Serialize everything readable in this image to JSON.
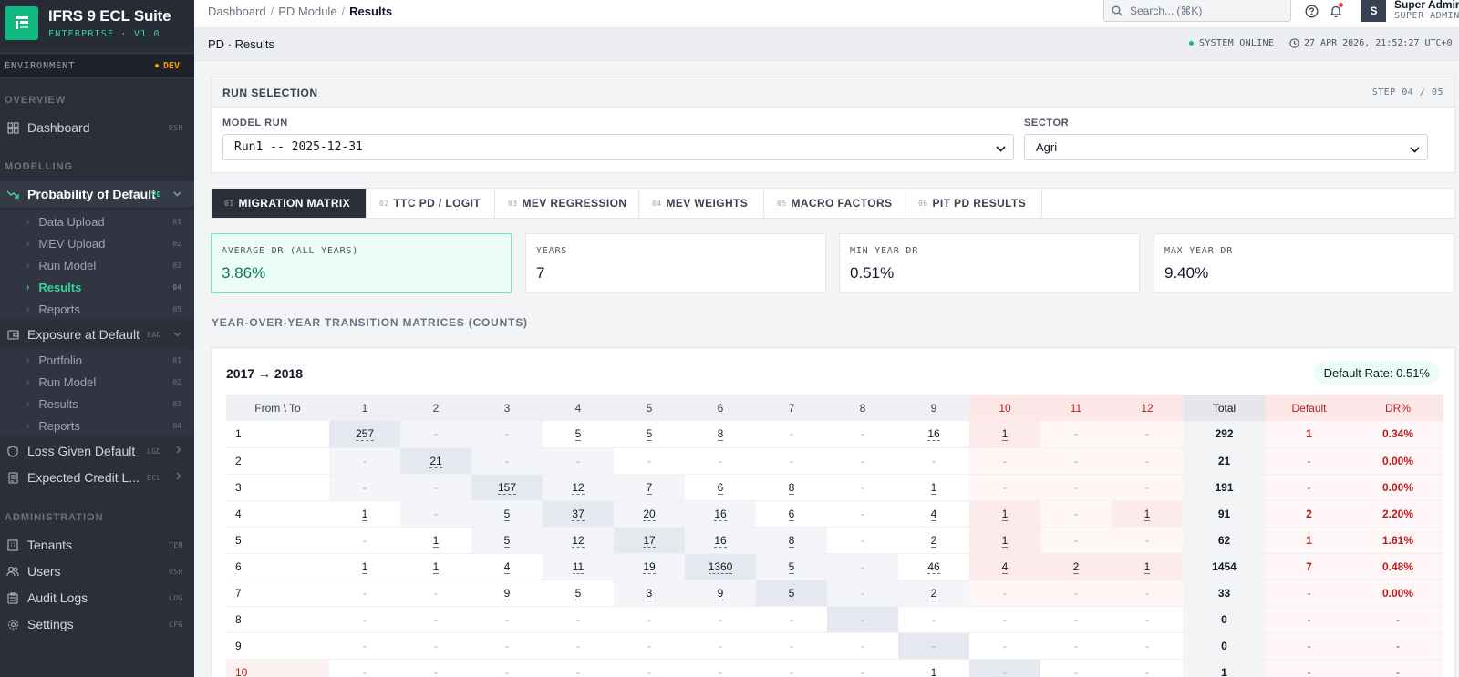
{
  "brand": {
    "title": "IFRS 9 ECL Suite",
    "subtitle": "ENTERPRISE · V1.0"
  },
  "environment": {
    "label": "ENVIRONMENT",
    "value": "DEV"
  },
  "sidebar": {
    "overview_label": "OVERVIEW",
    "modelling_label": "MODELLING",
    "admin_label": "ADMINISTRATION",
    "dashboard": {
      "label": "Dashboard",
      "code": "DSH"
    },
    "pd": {
      "label": "Probability of Default",
      "code": "PD",
      "items": [
        {
          "label": "Data Upload",
          "num": "01"
        },
        {
          "label": "MEV Upload",
          "num": "02"
        },
        {
          "label": "Run Model",
          "num": "03"
        },
        {
          "label": "Results",
          "num": "04"
        },
        {
          "label": "Reports",
          "num": "05"
        }
      ]
    },
    "ead": {
      "label": "Exposure at Default",
      "code": "EAD",
      "items": [
        {
          "label": "Portfolio",
          "num": "01"
        },
        {
          "label": "Run Model",
          "num": "02"
        },
        {
          "label": "Results",
          "num": "03"
        },
        {
          "label": "Reports",
          "num": "04"
        }
      ]
    },
    "lgd": {
      "label": "Loss Given Default",
      "code": "LGD"
    },
    "ecl": {
      "label": "Expected Credit L...",
      "code": "ECL"
    },
    "tenants": {
      "label": "Tenants",
      "code": "TEN"
    },
    "users": {
      "label": "Users",
      "code": "USR"
    },
    "audit": {
      "label": "Audit Logs",
      "code": "LOG"
    },
    "settings": {
      "label": "Settings",
      "code": "CFG"
    }
  },
  "topbar": {
    "breadcrumb": [
      "Dashboard",
      "PD Module",
      "Results"
    ],
    "search_placeholder": "Search... (⌘K)",
    "user_initial": "S",
    "user_name": "Super Admin",
    "user_role": "SUPER ADMIN"
  },
  "pageheader": {
    "title": "PD · Results",
    "status": "SYSTEM ONLINE",
    "datetime": "27 APR 2026, 21:52:27 UTC+0"
  },
  "run_selection": {
    "title": "RUN SELECTION",
    "step": "STEP 04 / 05",
    "model_run_label": "MODEL RUN",
    "model_run_value": "Run1 -- 2025-12-31",
    "sector_label": "SECTOR",
    "sector_value": "Agri"
  },
  "tabs": [
    {
      "num": "01",
      "label": "MIGRATION MATRIX"
    },
    {
      "num": "02",
      "label": "TTC PD / LOGIT"
    },
    {
      "num": "03",
      "label": "MEV REGRESSION"
    },
    {
      "num": "04",
      "label": "MEV WEIGHTS"
    },
    {
      "num": "05",
      "label": "MACRO FACTORS"
    },
    {
      "num": "06",
      "label": "PIT PD RESULTS"
    }
  ],
  "kpis": [
    {
      "label": "AVERAGE DR (ALL YEARS)",
      "value": "3.86%"
    },
    {
      "label": "YEARS",
      "value": "7"
    },
    {
      "label": "MIN YEAR DR",
      "value": "0.51%"
    },
    {
      "label": "MAX YEAR DR",
      "value": "9.40%"
    }
  ],
  "section_title": "YEAR-OVER-YEAR TRANSITION MATRICES (COUNTS)",
  "matrix": {
    "title": "2017 → 2018",
    "default_rate": "Default Rate: 0.51%",
    "corner": "From \\ To",
    "columns": [
      "1",
      "2",
      "3",
      "4",
      "5",
      "6",
      "7",
      "8",
      "9",
      "10",
      "11",
      "12"
    ],
    "total_label": "Total",
    "default_label": "Default",
    "dr_label": "DR%",
    "rows": [
      {
        "from": "1",
        "cells": [
          "257",
          "-",
          "-",
          "5",
          "5",
          "8",
          "-",
          "-",
          "16",
          "1",
          "-",
          "-"
        ],
        "total": "292",
        "default": "1",
        "dr": "0.34%"
      },
      {
        "from": "2",
        "cells": [
          "-",
          "21",
          "-",
          "-",
          "-",
          "-",
          "-",
          "-",
          "-",
          "-",
          "-",
          "-"
        ],
        "total": "21",
        "default": "-",
        "dr": "0.00%"
      },
      {
        "from": "3",
        "cells": [
          "-",
          "-",
          "157",
          "12",
          "7",
          "6",
          "8",
          "-",
          "1",
          "-",
          "-",
          "-"
        ],
        "total": "191",
        "default": "-",
        "dr": "0.00%"
      },
      {
        "from": "4",
        "cells": [
          "1",
          "-",
          "5",
          "37",
          "20",
          "16",
          "6",
          "-",
          "4",
          "1",
          "-",
          "1"
        ],
        "total": "91",
        "default": "2",
        "dr": "2.20%"
      },
      {
        "from": "5",
        "cells": [
          "-",
          "1",
          "5",
          "12",
          "17",
          "16",
          "8",
          "-",
          "2",
          "1",
          "-",
          "-"
        ],
        "total": "62",
        "default": "1",
        "dr": "1.61%"
      },
      {
        "from": "6",
        "cells": [
          "1",
          "1",
          "4",
          "11",
          "19",
          "1360",
          "5",
          "-",
          "46",
          "4",
          "2",
          "1"
        ],
        "total": "1454",
        "default": "7",
        "dr": "0.48%"
      },
      {
        "from": "7",
        "cells": [
          "-",
          "-",
          "9",
          "5",
          "3",
          "9",
          "5",
          "-",
          "2",
          "-",
          "-",
          "-"
        ],
        "total": "33",
        "default": "-",
        "dr": "0.00%"
      },
      {
        "from": "8",
        "cells": [
          "-",
          "-",
          "-",
          "-",
          "-",
          "-",
          "-",
          "-",
          "-",
          "-",
          "-",
          "-"
        ],
        "total": "0",
        "default": "-",
        "dr": "-"
      },
      {
        "from": "9",
        "cells": [
          "-",
          "-",
          "-",
          "-",
          "-",
          "-",
          "-",
          "-",
          "-",
          "-",
          "-",
          "-"
        ],
        "total": "0",
        "default": "-",
        "dr": "-"
      },
      {
        "from": "10",
        "cells": [
          "-",
          "-",
          "-",
          "-",
          "-",
          "-",
          "-",
          "-",
          "1",
          "-",
          "-",
          "-"
        ],
        "total": "1",
        "default": "-",
        "dr": "-"
      }
    ]
  },
  "colors": {
    "accent": "#10b981",
    "sidebar": "#2b2f3a",
    "default_red": "#b91c1c",
    "env_badge": "#f59e0b"
  }
}
